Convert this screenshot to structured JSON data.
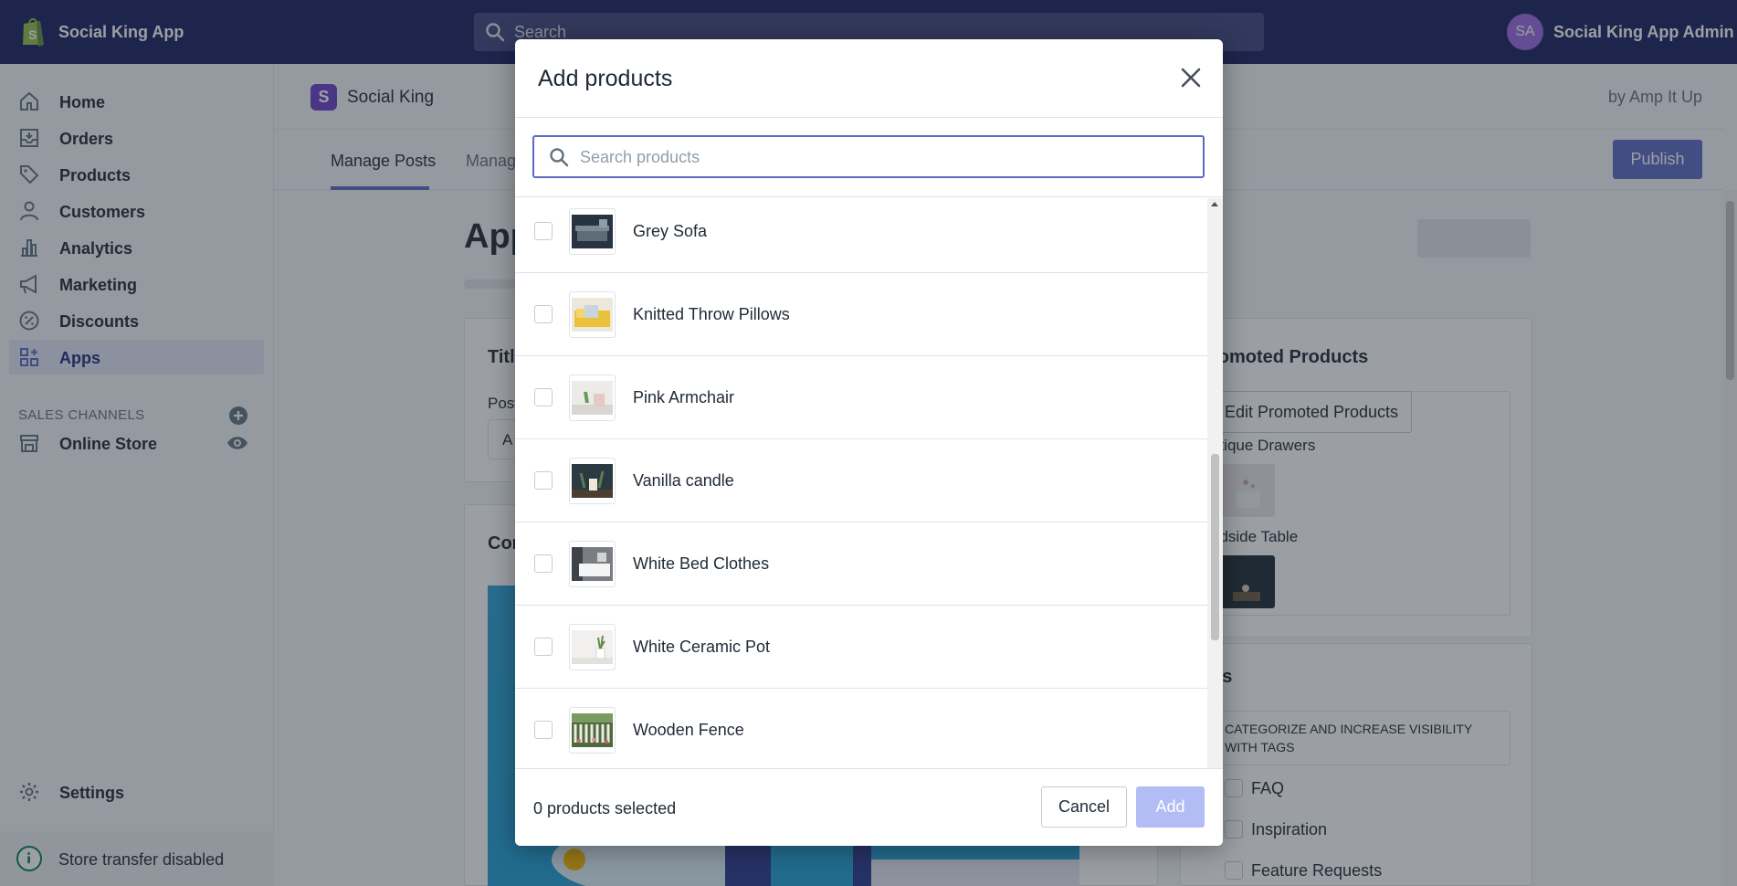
{
  "topbar": {
    "store_name": "Social King App",
    "search_placeholder": "Search",
    "avatar_initials": "SA",
    "admin_name": "Social King App Admin"
  },
  "sidebar": {
    "items": [
      {
        "label": "Home",
        "icon": "home-icon"
      },
      {
        "label": "Orders",
        "icon": "orders-icon"
      },
      {
        "label": "Products",
        "icon": "tag-icon"
      },
      {
        "label": "Customers",
        "icon": "person-icon"
      },
      {
        "label": "Analytics",
        "icon": "bar-chart-icon"
      },
      {
        "label": "Marketing",
        "icon": "megaphone-icon"
      },
      {
        "label": "Discounts",
        "icon": "discount-icon"
      },
      {
        "label": "Apps",
        "icon": "apps-icon",
        "active": true
      }
    ],
    "sales_channels_header": "SALES CHANNELS",
    "online_store": "Online Store",
    "settings": "Settings",
    "store_transfer": "Store transfer disabled"
  },
  "app": {
    "logo_letter": "S",
    "title": "Social King",
    "by": "by Amp It Up",
    "tabs": [
      "Manage Posts",
      "Manag"
    ],
    "publish": "Publish",
    "page_title": "App",
    "title_card_heading": "Titl",
    "post_label": "Post",
    "input_partial": "A",
    "content_heading": "Con",
    "promoted_heading": "romoted Products",
    "edit_promoted": "Edit Promoted Products",
    "promoted_items": [
      "ntique Drawers",
      "edside Table"
    ],
    "tags_heading": "gs",
    "tags_hint_line1": "CATEGORIZE AND INCREASE VISIBILITY",
    "tags_hint_line2": "WITH TAGS",
    "tags": [
      "FAQ",
      "Inspiration",
      "Feature Requests"
    ]
  },
  "modal": {
    "title": "Add products",
    "search_placeholder": "Search products",
    "products": [
      {
        "name": "Grey Sofa",
        "thumb": "sofa"
      },
      {
        "name": "Knitted Throw Pillows",
        "thumb": "pillows"
      },
      {
        "name": "Pink Armchair",
        "thumb": "armchair"
      },
      {
        "name": "Vanilla candle",
        "thumb": "candle"
      },
      {
        "name": "White Bed Clothes",
        "thumb": "bed"
      },
      {
        "name": "White Ceramic Pot",
        "thumb": "pot"
      },
      {
        "name": "Wooden Fence",
        "thumb": "fence"
      }
    ],
    "selected_count": "0 products selected",
    "cancel": "Cancel",
    "add": "Add"
  },
  "colors": {
    "topbar": "#1c2260",
    "accent": "#5c6ac4",
    "add_disabled": "#b3bcf5"
  }
}
